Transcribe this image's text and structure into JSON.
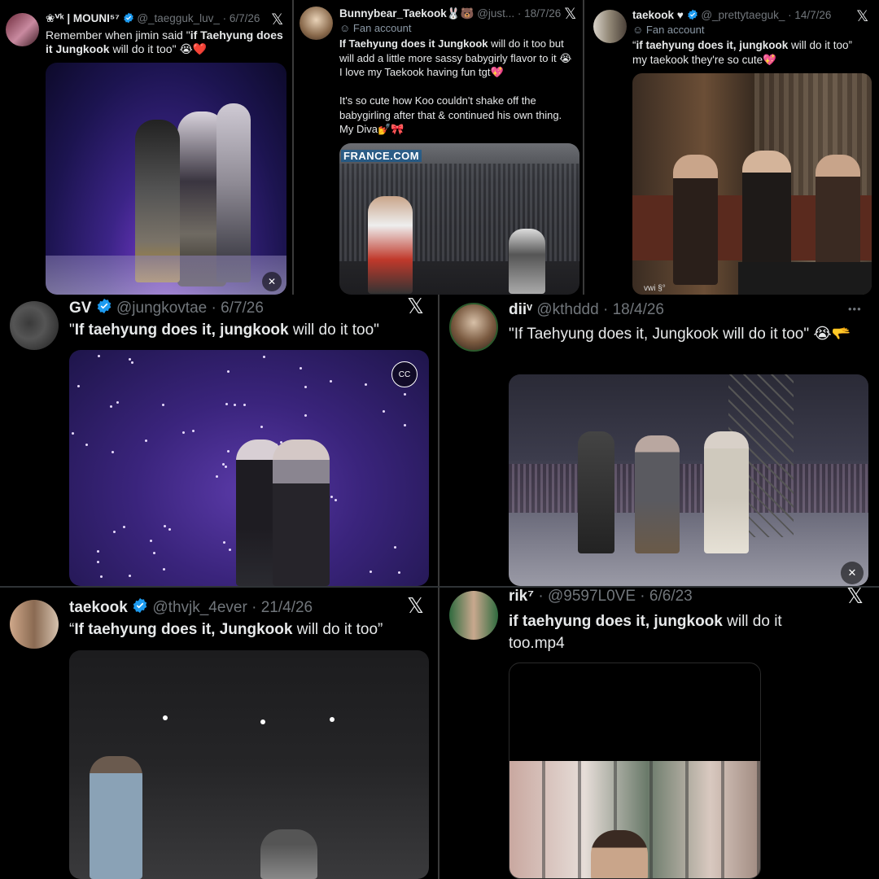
{
  "tweets": [
    {
      "name": "❀ⱽᵏ | MOUNI⁵⁷",
      "handle": "@_taegguk_luv_",
      "date": "· 6/7/26",
      "body_pre": "Remember when jimin said \"",
      "body_bold": "if Taehyung does it Jungkook",
      "body_post": " will do it too\" 😭❤️"
    },
    {
      "name": "Bunnybear_Taekook🐰🐻",
      "handle": "@just...",
      "date": "· 18/7/26",
      "fan_label": "Fan account",
      "body_bold": "If Taehyung does it Jungkook",
      "body_post": " will do it too but will add a little more sassy babygirly flavor to it 😭 I love my Taekook having fun tgt💖",
      "body_para2": "It's so cute how Koo couldn't shake off the babygirling after that & continued his own thing. My Diva💅🎀",
      "watermark": "FRANCE.COM"
    },
    {
      "name": "taekook ♥",
      "handle": "@_prettytaeguk_",
      "date": "· 14/7/26",
      "fan_label": "Fan account",
      "body_pre": "“",
      "body_bold": "if taehyung does it, jungkook",
      "body_post": " will do it too”",
      "body_line2": "my taekook they're so cute💖",
      "watermark": "vwi §°"
    },
    {
      "name": "GV",
      "handle": "@jungkovtae",
      "date": "· 6/7/26",
      "body_pre": "\"",
      "body_bold": "If taehyung does it, jungkook",
      "body_post": " will do it too\""
    },
    {
      "name": "diiᵛ",
      "handle": "@kthddd",
      "date": "· 18/4/26",
      "body": "\"If Taehyung does it, Jungkook will do it too\" 😭🫳",
      "more": "•••"
    },
    {
      "name": "taekook",
      "handle": "@thvjk_4ever",
      "date": "· 21/4/26",
      "body_pre": "“",
      "body_bold": "If taehyung does it, Jungkook",
      "body_post": " will do it too”"
    },
    {
      "name": "rik⁷",
      "handle": "· @9597L0VE",
      "date": "· 6/6/23",
      "body_bold": "if taehyung does it, jungkook",
      "body_post": " will do it too.mp4"
    }
  ],
  "icons": {
    "x_logo": "𝕏",
    "verified_color": "#1d9bf0",
    "mute": "mute-icon",
    "cc": "CC"
  },
  "colors": {
    "bg": "#000000",
    "text": "#e7e9ea",
    "muted": "#71767b",
    "concert_purple": "#4b2f8f"
  }
}
